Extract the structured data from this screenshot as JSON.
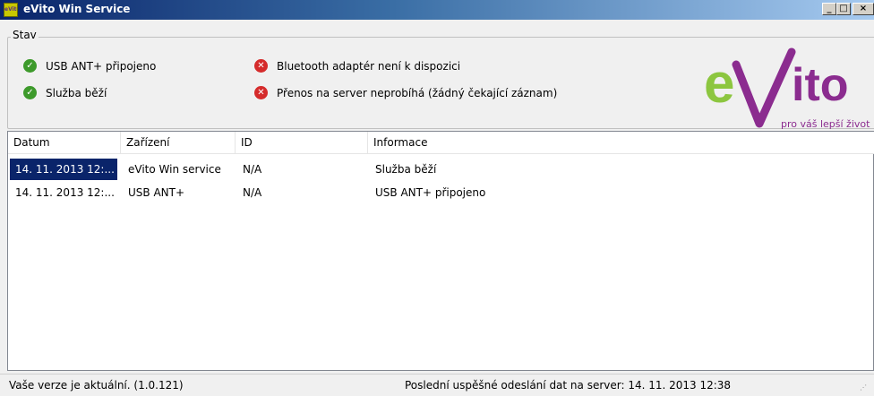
{
  "window": {
    "title": "eVito Win Service",
    "icon_text": "eVito",
    "buttons": {
      "minimize": "_",
      "maximize": "□",
      "close": "×"
    }
  },
  "status_group": {
    "legend": "Stav",
    "items": [
      {
        "text": "USB ANT+ připojeno",
        "state": "ok"
      },
      {
        "text": "Služba běží",
        "state": "ok"
      },
      {
        "text": "Bluetooth adaptér není k dispozici",
        "state": "error"
      },
      {
        "text": "Přenos na server neprobíhá  (žádný čekající záznam)",
        "state": "error"
      }
    ]
  },
  "logo": {
    "tagline": "pro váš lepší život",
    "brand_colors": {
      "green": "#8cc63f",
      "purple": "#8b2c8f"
    }
  },
  "list": {
    "columns": [
      "Datum",
      "Zařízení",
      "ID",
      "Informace"
    ],
    "rows": [
      [
        "14. 11. 2013 12:...",
        "eVito Win service",
        "N/A",
        "Služba běží"
      ],
      [
        "14. 11. 2013 12:...",
        "USB ANT+",
        "N/A",
        "USB ANT+ připojeno"
      ]
    ],
    "selected_cell": "14. 11. 2013 12:..."
  },
  "statusbar": {
    "version": "Vaše verze je aktuální. (1.0.121)",
    "last_upload": "Poslední uspěšné odeslání dat na server: 14. 11. 2013 12:38"
  }
}
